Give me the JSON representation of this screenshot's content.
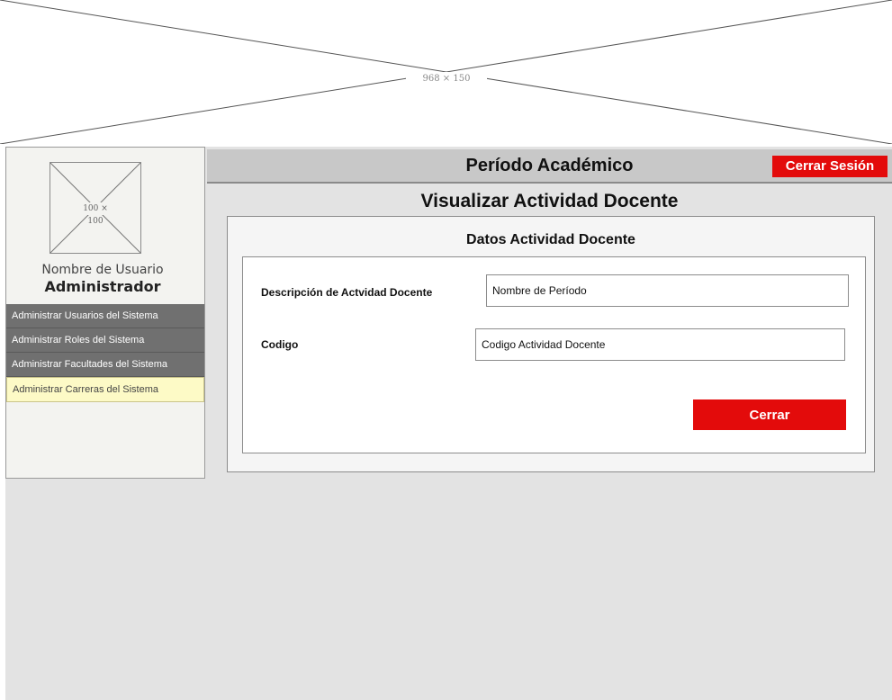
{
  "banner": {
    "placeholder_label": "968 × 150"
  },
  "sidebar": {
    "avatar_placeholder_label": "100 × 100",
    "user_name": "Nombre de Usuario",
    "user_role": "Administrador",
    "menu": [
      {
        "label": "Administrar Usuarios del Sistema",
        "active": false
      },
      {
        "label": "Administrar Roles del Sistema",
        "active": false
      },
      {
        "label": "Administrar Facultades del Sistema",
        "active": false
      },
      {
        "label": "Administrar Carreras del Sistema",
        "active": true
      }
    ]
  },
  "header": {
    "title": "Período Académico",
    "logout_label": "Cerrar Sesión"
  },
  "main": {
    "view_title": "Visualizar Actividad Docente",
    "panel_title": "Datos Actividad Docente",
    "fields": {
      "description": {
        "label": "Descripción de Actvidad Docente",
        "value": "Nombre de Período"
      },
      "code": {
        "label": "Codigo",
        "value": "Codigo Actividad Docente"
      }
    },
    "close_label": "Cerrar"
  },
  "colors": {
    "accent_red": "#e30b0b",
    "menu_gray": "#707070",
    "menu_active": "#fdfac6",
    "page_bg": "#e3e3e3"
  }
}
